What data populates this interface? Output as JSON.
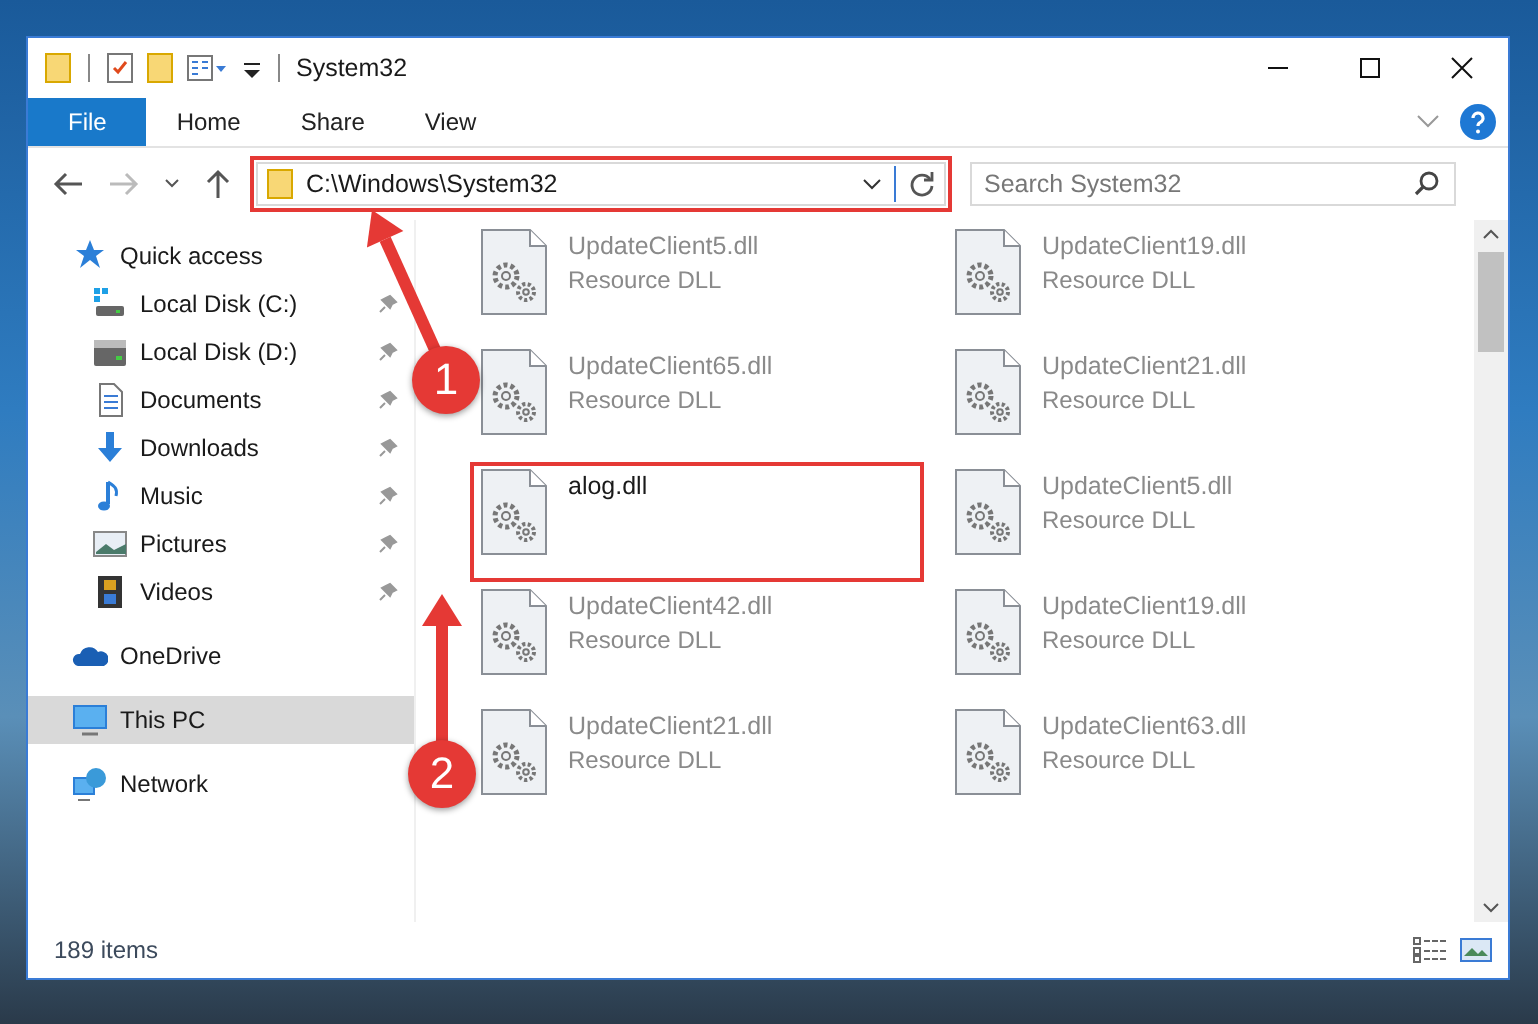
{
  "window": {
    "title": "System32"
  },
  "ribbon_tabs": [
    {
      "label": "File",
      "selected": true
    },
    {
      "label": "Home",
      "selected": false
    },
    {
      "label": "Share",
      "selected": false
    },
    {
      "label": "View",
      "selected": false
    }
  ],
  "address_bar": {
    "path": "C:\\Windows\\System32",
    "highlighted": true
  },
  "search": {
    "placeholder": "Search System32"
  },
  "sidebar": {
    "items": [
      {
        "label": "Quick access",
        "kind": "star",
        "selected": false,
        "children": [
          {
            "label": "Local Disk (C:)",
            "kind": "sysdisk",
            "pinned": true,
            "selected": false
          },
          {
            "label": "Local Disk (D:)",
            "kind": "disk",
            "pinned": true,
            "selected": false
          },
          {
            "label": "Documents",
            "kind": "doc",
            "pinned": true,
            "selected": false
          },
          {
            "label": "Downloads",
            "kind": "download",
            "pinned": true,
            "selected": false
          },
          {
            "label": "Music",
            "kind": "music",
            "pinned": true,
            "selected": false
          },
          {
            "label": "Pictures",
            "kind": "picture",
            "pinned": true,
            "selected": false
          },
          {
            "label": "Videos",
            "kind": "video",
            "pinned": true,
            "selected": false
          }
        ]
      },
      {
        "label": "OneDrive",
        "kind": "cloud",
        "selected": false
      },
      {
        "label": "This PC",
        "kind": "pc",
        "selected": true
      },
      {
        "label": "Network",
        "kind": "network",
        "selected": false
      }
    ]
  },
  "files": [
    {
      "name": "UpdateClient5.dll",
      "type": "Resource DLL",
      "blurred": true,
      "highlighted": false
    },
    {
      "name": "UpdateClient19.dll",
      "type": "Resource DLL",
      "blurred": true,
      "highlighted": false
    },
    {
      "name": "UpdateClient65.dll",
      "type": "Resource DLL",
      "blurred": true,
      "highlighted": false
    },
    {
      "name": "UpdateClient21.dll",
      "type": "Resource DLL",
      "blurred": true,
      "highlighted": false
    },
    {
      "name": "alog.dll",
      "blurred": false,
      "highlighted": true
    },
    {
      "name": "UpdateClient5.dll",
      "type": "Resource DLL",
      "blurred": true,
      "highlighted": false
    },
    {
      "name": "UpdateClient42.dll",
      "type": "Resource DLL",
      "blurred": true,
      "highlighted": false
    },
    {
      "name": "UpdateClient19.dll",
      "type": "Resource DLL",
      "blurred": true,
      "highlighted": false
    },
    {
      "name": "UpdateClient21.dll",
      "type": "Resource DLL",
      "blurred": true,
      "highlighted": false
    },
    {
      "name": "UpdateClient63.dll",
      "type": "Resource DLL",
      "blurred": true,
      "highlighted": false
    }
  ],
  "status_bar": {
    "item_count": "189 items"
  },
  "annotations": [
    {
      "number": "1"
    },
    {
      "number": "2"
    }
  ]
}
